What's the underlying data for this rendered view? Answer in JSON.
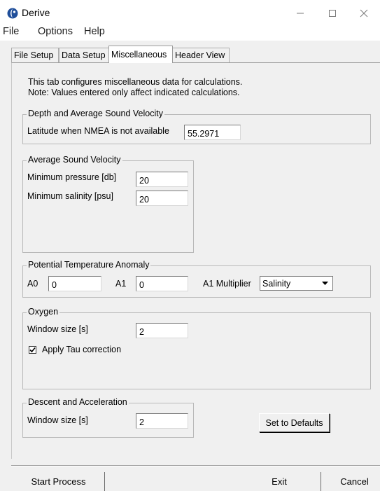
{
  "window": {
    "title": "Derive",
    "icon": "derive-app-icon",
    "controls": [
      "minimize-icon",
      "maximize-icon",
      "close-icon"
    ]
  },
  "menu": {
    "file": "File",
    "options": "Options",
    "help": "Help"
  },
  "tabs": {
    "file_setup": "File Setup",
    "data_setup": "Data Setup",
    "miscellaneous": "Miscellaneous",
    "header_view": "Header View",
    "active": "Miscellaneous"
  },
  "notes": {
    "line1": "This tab configures miscellaneous data for calculations.",
    "line2": "Note: Values entered only affect indicated calculations."
  },
  "depth_group": {
    "title": "Depth and Average Sound Velocity",
    "latitude_label": "Latitude when NMEA is not available",
    "latitude_value": "55.2971"
  },
  "avg_sound_group": {
    "title": "Average Sound Velocity",
    "min_pressure_label": "Minimum pressure [db]",
    "min_pressure_value": "20",
    "min_salinity_label": "Minimum salinity [psu]",
    "min_salinity_value": "20"
  },
  "pta_group": {
    "title": "Potential Temperature Anomaly",
    "a0_label": "A0",
    "a0_value": "0",
    "a1_label": "A1",
    "a1_value": "0",
    "multiplier_label": "A1 Multiplier",
    "multiplier_value": "Salinity"
  },
  "oxygen_group": {
    "title": "Oxygen",
    "window_label": "Window size [s]",
    "window_value": "2",
    "tau_label": "Apply Tau correction",
    "tau_checked": true
  },
  "descent_group": {
    "title": "Descent and Acceleration",
    "window_label": "Window size [s]",
    "window_value": "2"
  },
  "buttons": {
    "defaults": "Set to Defaults",
    "start": "Start Process",
    "exit": "Exit",
    "cancel": "Cancel"
  },
  "colors": {
    "background": "#f0f0f0",
    "window": "#ffffff",
    "group_border": "#b9b9b9",
    "icon_blue": "#1a73c8"
  }
}
